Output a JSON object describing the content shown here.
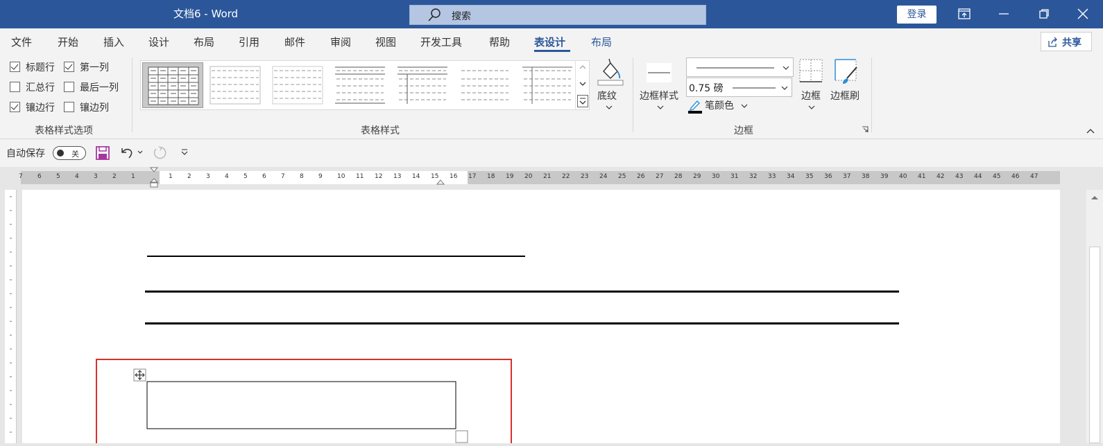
{
  "title_bar": {
    "doc_title": "文档6  -  Word",
    "search_placeholder": "搜索",
    "login_label": "登录"
  },
  "tabs": [
    {
      "label": "文件"
    },
    {
      "label": "开始"
    },
    {
      "label": "插入"
    },
    {
      "label": "设计"
    },
    {
      "label": "布局"
    },
    {
      "label": "引用"
    },
    {
      "label": "邮件"
    },
    {
      "label": "审阅"
    },
    {
      "label": "视图"
    },
    {
      "label": "开发工具"
    },
    {
      "label": "帮助"
    },
    {
      "label": "表设计",
      "active": true
    },
    {
      "label": "布局"
    }
  ],
  "share_label": "共享",
  "style_options": {
    "items": [
      {
        "label": "标题行",
        "checked": true
      },
      {
        "label": "第一列",
        "checked": true
      },
      {
        "label": "汇总行",
        "checked": false
      },
      {
        "label": "最后一列",
        "checked": false
      },
      {
        "label": "镶边行",
        "checked": true
      },
      {
        "label": "镶边列",
        "checked": false
      }
    ],
    "group_label": "表格样式选项"
  },
  "table_styles": {
    "group_label": "表格样式",
    "shading_label": "底纹"
  },
  "borders": {
    "border_styles_label": "边框样式",
    "line_weight": "0.75 磅",
    "pen_color_label": "笔颜色",
    "borders_label": "边框",
    "border_painter_label": "边框刷",
    "group_label": "边框"
  },
  "qat": {
    "autosave_label": "自动保存",
    "toggle_state": "关"
  },
  "ruler": {
    "labels": [
      "7",
      "6",
      "5",
      "4",
      "3",
      "2",
      "1",
      "",
      "1",
      "2",
      "3",
      "4",
      "5",
      "6",
      "7",
      "8",
      "9",
      "10",
      "11",
      "12",
      "13",
      "14",
      "15",
      "16",
      "17",
      "18",
      "19",
      "20",
      "21",
      "22",
      "23",
      "24",
      "25",
      "26",
      "27",
      "28",
      "29",
      "30",
      "31",
      "32",
      "33",
      "34",
      "35",
      "36",
      "37",
      "38",
      "39",
      "40",
      "41",
      "42",
      "43",
      "44",
      "45",
      "46",
      "47"
    ]
  },
  "colors": {
    "accent": "#2b579a",
    "highlight_border": "#d9302c"
  }
}
